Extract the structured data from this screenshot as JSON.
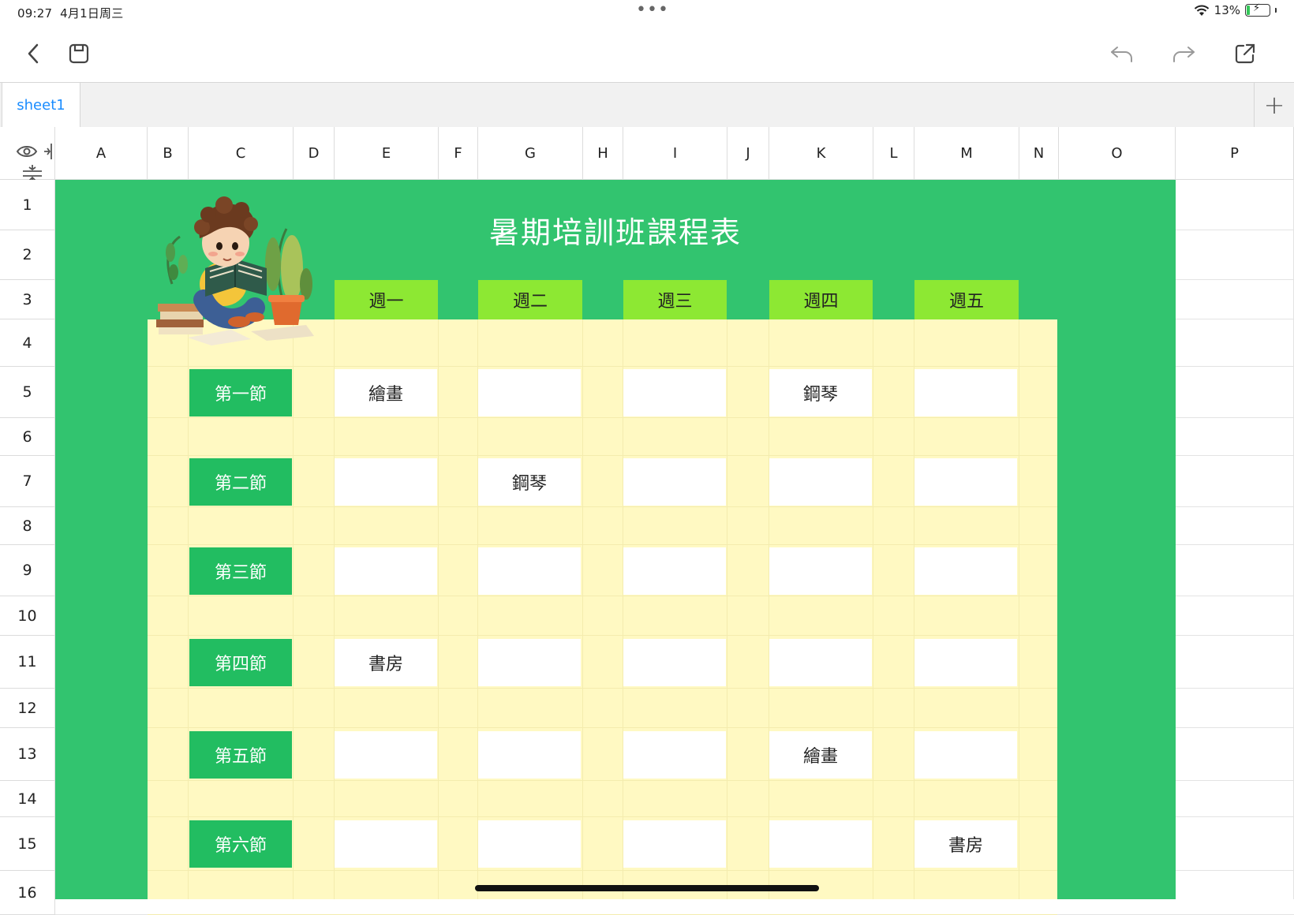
{
  "status_bar": {
    "time": "09:27",
    "date": "4月1日周三",
    "battery_percent": "13%"
  },
  "toolbar": {
    "back_icon": "chevron-left-icon",
    "save_icon": "save-icon",
    "undo_icon": "undo-icon",
    "redo_icon": "redo-icon",
    "share_icon": "share-icon"
  },
  "tabs": {
    "active_sheet": "sheet1",
    "add_label": "+"
  },
  "columns": [
    "A",
    "B",
    "C",
    "D",
    "E",
    "F",
    "G",
    "H",
    "I",
    "J",
    "K",
    "L",
    "M",
    "N",
    "O",
    "P"
  ],
  "rows": [
    "1",
    "2",
    "3",
    "4",
    "5",
    "6",
    "7",
    "8",
    "9",
    "10",
    "11",
    "12",
    "13",
    "14",
    "15",
    "16"
  ],
  "schedule": {
    "title": "暑期培訓班課程表",
    "days": [
      "週一",
      "週二",
      "週三",
      "週四",
      "週五"
    ],
    "periods": [
      "第一節",
      "第二節",
      "第三節",
      "第四節",
      "第五節",
      "第六節"
    ],
    "slots": [
      [
        "繪畫",
        "",
        "",
        "鋼琴",
        ""
      ],
      [
        "",
        "鋼琴",
        "",
        "",
        ""
      ],
      [
        "",
        "",
        "",
        "",
        ""
      ],
      [
        "書房",
        "",
        "",
        "",
        ""
      ],
      [
        "",
        "",
        "",
        "繪畫",
        ""
      ],
      [
        "",
        "",
        "",
        "",
        "書房"
      ]
    ]
  },
  "colors": {
    "header_green": "#32c46f",
    "day_green": "#8de833",
    "period_green": "#22bd61",
    "body_yellow": "#fff9c2",
    "tab_blue": "#1a8cff"
  }
}
